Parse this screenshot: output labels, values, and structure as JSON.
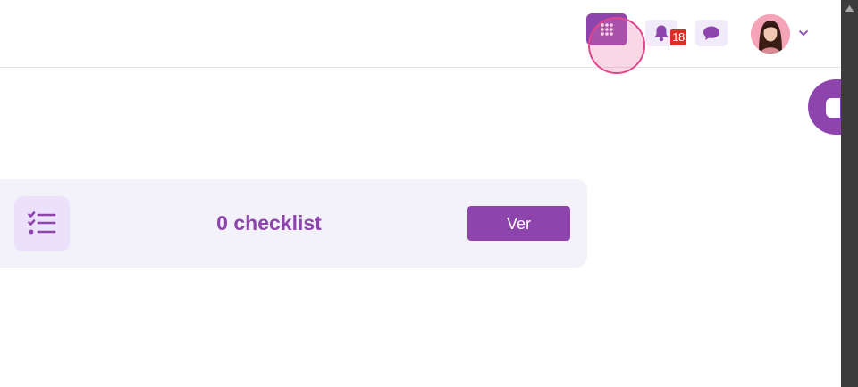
{
  "header": {
    "apps_icon": "grid-dots-icon",
    "notifications": {
      "icon": "bell-icon",
      "count": "18"
    },
    "messages_icon": "chat-bubble-icon",
    "avatar_icon": "user-avatar",
    "menu_icon": "chevron-down-icon"
  },
  "side_tab_icon": "side-tab-icon",
  "card": {
    "icon": "checklist-icon",
    "title": "0 checklist",
    "button_label": "Ver"
  },
  "colors": {
    "primary": "#8e44ad",
    "light_purple": "#f1eaf8",
    "card_bg": "#f3f1f9",
    "badge": "#d93025"
  }
}
